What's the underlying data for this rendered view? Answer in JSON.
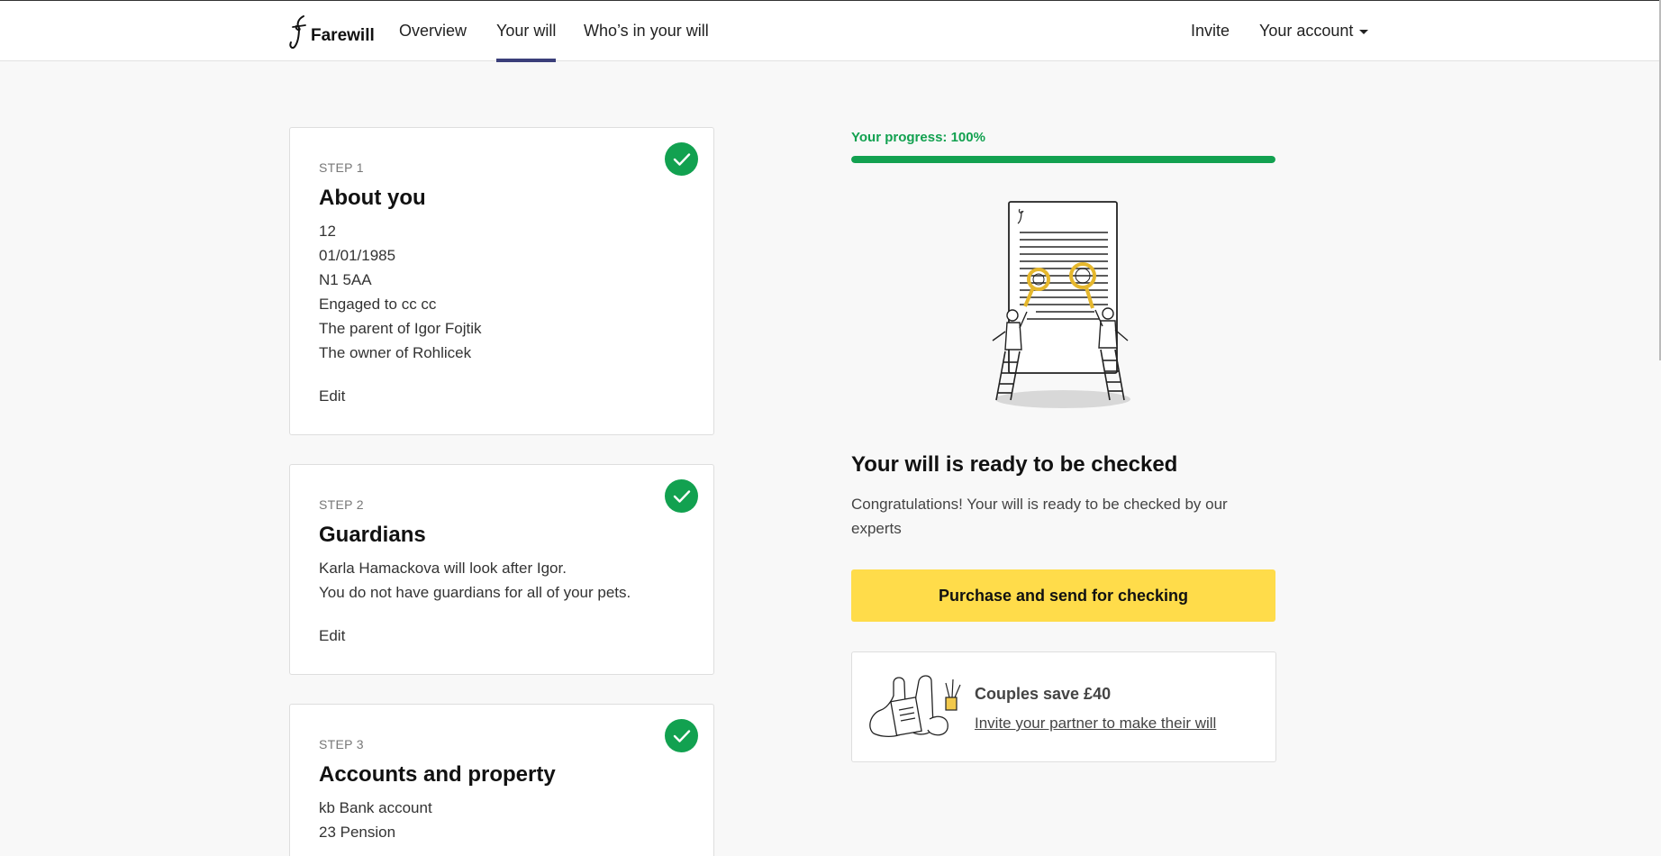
{
  "nav": {
    "brand": "Farewill",
    "overview": "Overview",
    "your_will": "Your will",
    "whos_in": "Who’s in your will",
    "invite": "Invite",
    "account": "Your account"
  },
  "steps": [
    {
      "label": "STEP 1",
      "title": "About you",
      "details": [
        "12",
        "01/01/1985",
        "N1 5AA",
        "Engaged to cc cc",
        "The parent of Igor Fojtik",
        "The owner of Rohlicek"
      ],
      "edit": "Edit"
    },
    {
      "label": "STEP 2",
      "title": "Guardians",
      "details": [
        "Karla Hamackova will look after Igor.",
        "You do not have guardians for all of your pets."
      ],
      "edit": "Edit"
    },
    {
      "label": "STEP 3",
      "title": "Accounts and property",
      "details": [
        "kb Bank account",
        "23 Pension"
      ]
    }
  ],
  "progress": {
    "label": "Your progress: 100%",
    "value": 1.0
  },
  "ready": {
    "title": "Your will is ready to be checked",
    "text": "Congratulations! Your will is ready to be checked by our experts",
    "button": "Purchase and send for checking"
  },
  "couples": {
    "title": "Couples save £40",
    "link": "Invite your partner to make their will"
  },
  "colors": {
    "accent_green": "#12a150",
    "button_yellow": "#ffdc4a",
    "nav_underline": "#3b3f7a"
  }
}
